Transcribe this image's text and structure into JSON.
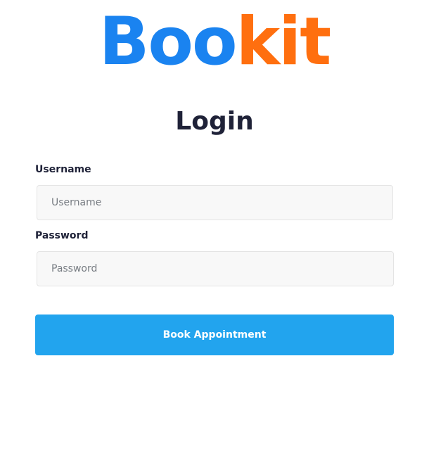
{
  "logo": {
    "part_a": "Boo",
    "part_b": "kit",
    "color_a": "#1a83f0",
    "color_b": "#ff6f0f"
  },
  "form": {
    "title": "Login",
    "username": {
      "label": "Username",
      "placeholder": "Username",
      "value": ""
    },
    "password": {
      "label": "Password",
      "placeholder": "Password",
      "value": ""
    },
    "submit_label": "Book Appointment"
  },
  "colors": {
    "accent": "#22a4ee",
    "heading": "#1f2238",
    "field_bg": "#f8f8f8"
  }
}
